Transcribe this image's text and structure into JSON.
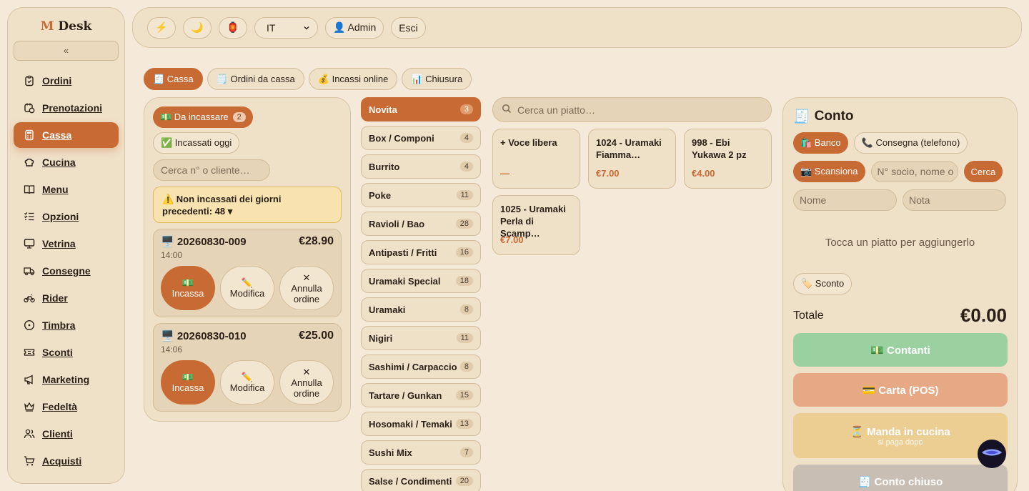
{
  "app": {
    "logo_m": "M",
    "logo_text": "Desk",
    "collapse_label": "«"
  },
  "sidebar": {
    "items": [
      {
        "label": "Ordini",
        "icon": "clipboard-icon"
      },
      {
        "label": "Prenotazioni",
        "icon": "calendar-clock-icon"
      },
      {
        "label": "Cassa",
        "icon": "calculator-icon",
        "active": true
      },
      {
        "label": "Cucina",
        "icon": "chef-hat-icon"
      },
      {
        "label": "Menu",
        "icon": "book-icon"
      },
      {
        "label": "Opzioni",
        "icon": "list-check-icon"
      },
      {
        "label": "Vetrina",
        "icon": "monitor-icon"
      },
      {
        "label": "Consegne",
        "icon": "truck-icon"
      },
      {
        "label": "Rider",
        "icon": "bike-icon"
      },
      {
        "label": "Timbra",
        "icon": "clock-icon"
      },
      {
        "label": "Sconti",
        "icon": "ticket-icon"
      },
      {
        "label": "Marketing",
        "icon": "megaphone-icon"
      },
      {
        "label": "Fedeltà",
        "icon": "crown-icon"
      },
      {
        "label": "Clienti",
        "icon": "users-icon"
      },
      {
        "label": "Acquisti",
        "icon": "cart-icon"
      }
    ]
  },
  "topbar": {
    "bolt": "⚡",
    "moon": "🌙",
    "lantern": "🏮",
    "language": "IT",
    "admin_label": "👤 Admin",
    "logout_label": "Esci"
  },
  "tabs": [
    {
      "label": "🧾 Cassa",
      "active": true
    },
    {
      "label": "🗒️ Ordini da cassa"
    },
    {
      "label": "💰 Incassi online"
    },
    {
      "label": "📊 Chiusura"
    }
  ],
  "orders": {
    "to_collect_label": "💵 Da incassare",
    "to_collect_count": "2",
    "collected_label": "✅ Incassati oggi",
    "search_placeholder": "Cerca n° o cliente…",
    "warning_text": "⚠️ Non incassati dei giorni precedenti: 48 ▾",
    "list": [
      {
        "number": "🖥️ 20260830-009",
        "total": "€28.90",
        "time": "14:00"
      },
      {
        "number": "🖥️ 20260830-010",
        "total": "€25.00",
        "time": "14:06"
      }
    ],
    "pay_icon": "💵",
    "pay_label": "Incassa",
    "edit_icon": "✏️",
    "edit_label": "Modifica",
    "cancel_icon": "✕",
    "cancel_label": "Annulla ordine"
  },
  "categories": [
    {
      "name": "Novita",
      "count": "3",
      "active": true
    },
    {
      "name": "Box / Componi",
      "count": "4"
    },
    {
      "name": "Burrito",
      "count": "4"
    },
    {
      "name": "Poke",
      "count": "11"
    },
    {
      "name": "Ravioli / Bao",
      "count": "28"
    },
    {
      "name": "Antipasti / Fritti",
      "count": "16"
    },
    {
      "name": "Uramaki Special",
      "count": "18"
    },
    {
      "name": "Uramaki",
      "count": "8"
    },
    {
      "name": "Nigiri",
      "count": "11"
    },
    {
      "name": "Sashimi / Carpaccio",
      "count": "8"
    },
    {
      "name": "Tartare / Gunkan",
      "count": "15"
    },
    {
      "name": "Hosomaki / Temaki",
      "count": "13"
    },
    {
      "name": "Sushi Mix",
      "count": "7"
    },
    {
      "name": "Salse / Condimenti",
      "count": "20"
    }
  ],
  "products": {
    "search_placeholder": "Cerca un piatto…",
    "items": [
      {
        "name": "+ Voce libera",
        "price": "—"
      },
      {
        "name": "1024 - Uramaki Fiamma…",
        "price": "€7.00"
      },
      {
        "name": "998 - Ebi Yukawa 2 pz",
        "price": "€4.00"
      },
      {
        "name": "1025 - Uramaki Perla di Scamp…",
        "price": "€7.00"
      }
    ]
  },
  "bill": {
    "title_icon": "🧾",
    "title": "Conto",
    "counter_label": "🛍️ Banco",
    "delivery_label": "📞 Consegna (telefono)",
    "scan_label": "📷 Scansiona",
    "member_placeholder": "N° socio, nome o",
    "search_label": "Cerca",
    "name_placeholder": "Nome",
    "note_placeholder": "Nota",
    "empty_text": "Tocca un piatto per aggiungerlo",
    "discount_label": "🏷️ Sconto",
    "total_label": "Totale",
    "total_value": "€0.00",
    "cash_label": "💵 Contanti",
    "card_label": "💳 Carta (POS)",
    "kitchen_label": "⏳ Manda in cucina",
    "kitchen_sub": "si paga dopo",
    "closed_label": "🧾 Conto chiuso"
  },
  "colors": {
    "accent": "#c86a33",
    "background": "#f5ead9",
    "panel": "#efe0c8"
  }
}
